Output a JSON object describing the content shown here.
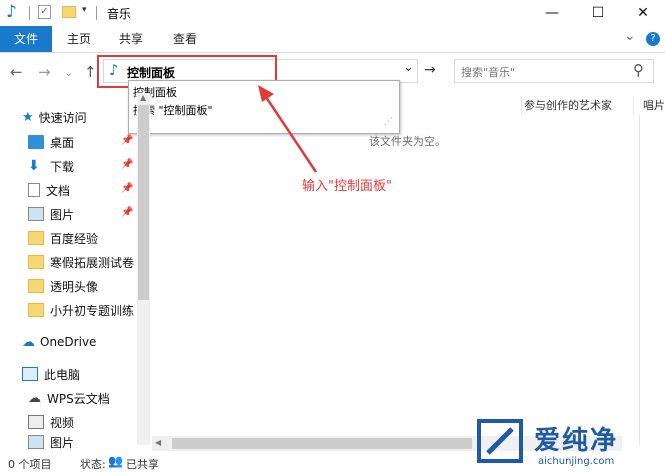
{
  "window": {
    "title": "音乐",
    "min_glyph": "—",
    "max_glyph": "☐",
    "close_glyph": "✕"
  },
  "ribbon": {
    "tabs": [
      {
        "label": "文件"
      },
      {
        "label": "主页"
      },
      {
        "label": "共享"
      },
      {
        "label": "查看"
      }
    ],
    "expand_glyph": "⌄",
    "help_glyph": "?"
  },
  "nav": {
    "back": "←",
    "forward": "→",
    "recent": "⌄",
    "up": "↑",
    "go": "→"
  },
  "address": {
    "value": "控制面板",
    "dropdown_glyph": "⌄"
  },
  "search": {
    "placeholder": "搜索\"音乐\"",
    "icon_glyph": "⚲"
  },
  "suggestions": [
    {
      "text": "控制面板"
    },
    {
      "text": "搜索 \"控制面板\""
    }
  ],
  "annotation": {
    "text": "输入\"控制面板\"",
    "color": "#e03a3a"
  },
  "sidebar": {
    "quick_access": "快速访问",
    "items": [
      {
        "label": "桌面",
        "pinned": true
      },
      {
        "label": "下载",
        "pinned": true
      },
      {
        "label": "文档",
        "pinned": true
      },
      {
        "label": "图片",
        "pinned": true
      },
      {
        "label": "百度经验",
        "pinned": false
      },
      {
        "label": "寒假拓展测试卷",
        "pinned": false
      },
      {
        "label": "透明头像",
        "pinned": false
      },
      {
        "label": "小升初专题训练",
        "pinned": false
      }
    ],
    "onedrive": "OneDrive",
    "this_pc": "此电脑",
    "pc_items": [
      {
        "label": "WPS云文档"
      },
      {
        "label": "视频"
      },
      {
        "label": "图片"
      }
    ]
  },
  "main": {
    "columns": [
      {
        "label": "参与创作的艺术家"
      },
      {
        "label": "唱片"
      }
    ],
    "empty_text": "该文件夹为空。"
  },
  "status": {
    "count": "0 个项目",
    "state_label": "状态:",
    "shared": "已共享"
  },
  "watermark": {
    "brand": "爱纯净",
    "url": "aichunjing.com"
  },
  "colors": {
    "accent": "#1979ca",
    "highlight": "#e03a3a"
  }
}
